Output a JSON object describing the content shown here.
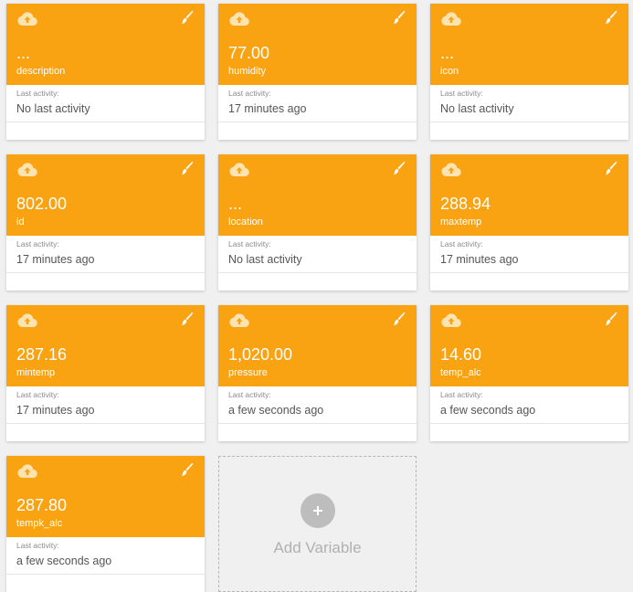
{
  "activity_label": "Last activity:",
  "variables": [
    {
      "value": "...",
      "name": "description",
      "last_activity": "No last activity"
    },
    {
      "value": "77.00",
      "name": "humidity",
      "last_activity": "17 minutes ago"
    },
    {
      "value": "...",
      "name": "icon",
      "last_activity": "No last activity"
    },
    {
      "value": "802.00",
      "name": "id",
      "last_activity": "17 minutes ago"
    },
    {
      "value": "...",
      "name": "location",
      "last_activity": "No last activity"
    },
    {
      "value": "288.94",
      "name": "maxtemp",
      "last_activity": "17 minutes ago"
    },
    {
      "value": "287.16",
      "name": "mintemp",
      "last_activity": "17 minutes ago"
    },
    {
      "value": "1,020.00",
      "name": "pressure",
      "last_activity": "a few seconds ago"
    },
    {
      "value": "14.60",
      "name": "temp_alc",
      "last_activity": "a few seconds ago"
    },
    {
      "value": "287.80",
      "name": "tempk_alc",
      "last_activity": "a few seconds ago"
    }
  ],
  "add_variable": {
    "label": "Add Variable",
    "icon": "plus-icon"
  },
  "icons": {
    "card_top_left": "cloud-upload-icon",
    "card_top_right": "paintbrush-icon"
  },
  "colors": {
    "card_header": "#f9a313",
    "background": "#f0f0f0"
  }
}
